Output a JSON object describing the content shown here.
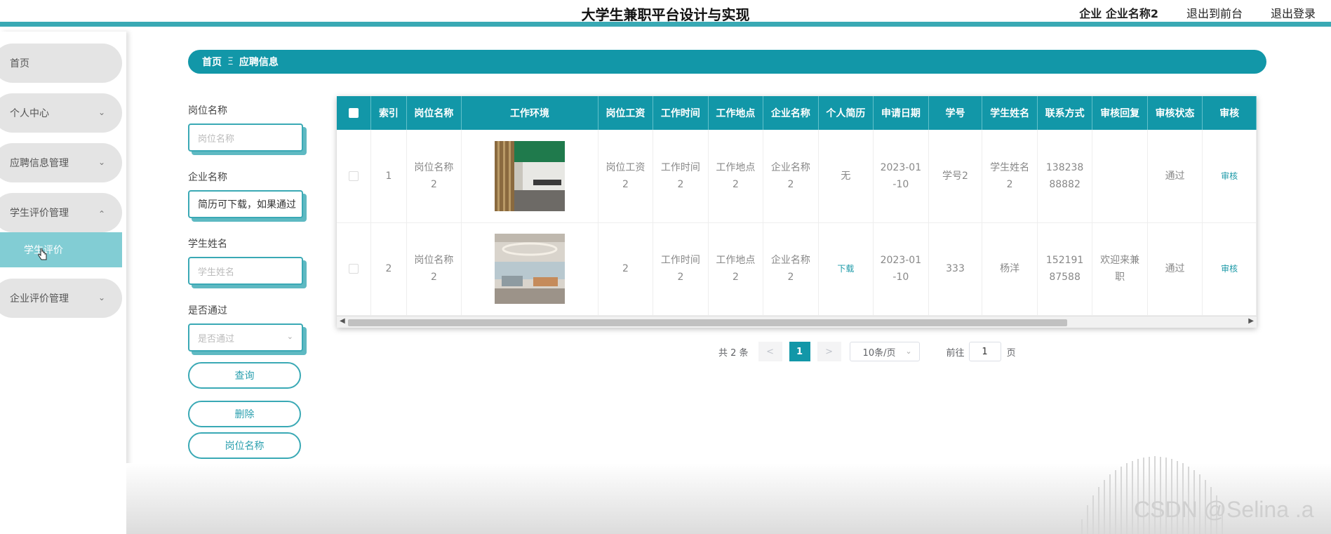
{
  "header": {
    "title": "大学生兼职平台设计与实现",
    "user_label": "企业 企业名称2",
    "to_front": "退出到前台",
    "logout": "退出登录"
  },
  "sidebar": {
    "items": [
      {
        "label": "首页"
      },
      {
        "label": "个人中心"
      },
      {
        "label": "应聘信息管理"
      },
      {
        "label": "学生评价管理"
      },
      {
        "label": "学生评价"
      },
      {
        "label": "企业评价管理"
      }
    ]
  },
  "breadcrumb": {
    "home": "首页",
    "sep": "Ξ",
    "current": "应聘信息"
  },
  "filters": {
    "job_label": "岗位名称",
    "job_placeholder": "岗位名称",
    "company_label": "企业名称",
    "company_value": "简历可下载，如果通过",
    "student_label": "学生姓名",
    "student_placeholder": "学生姓名",
    "pass_label": "是否通过",
    "pass_placeholder": "是否通过",
    "query_btn": "查询",
    "delete_btn": "删除",
    "job_btn": "岗位名称"
  },
  "table": {
    "headers": [
      "索引",
      "岗位名称",
      "工作环境",
      "岗位工资",
      "工作时间",
      "工作地点",
      "企业名称",
      "个人简历",
      "申请日期",
      "学号",
      "学生姓名",
      "联系方式",
      "审核回复",
      "审核状态",
      "审核"
    ],
    "rows": [
      {
        "index": "1",
        "job": "岗位名称2",
        "salary": "岗位工资2",
        "time": "工作时间2",
        "place": "工作地点2",
        "company": "企业名称2",
        "resume": "无",
        "date": "2023-01-10",
        "sno": "学号2",
        "sname": "学生姓名2",
        "phone": "13823888882",
        "reply": "",
        "status": "通过",
        "action": "审核"
      },
      {
        "index": "2",
        "job": "岗位名称2",
        "salary": "2",
        "time": "工作时间2",
        "place": "工作地点2",
        "company": "企业名称2",
        "resume": "下载",
        "date": "2023-01-10",
        "sno": "333",
        "sname": "杨洋",
        "phone": "15219187588",
        "reply": "欢迎来兼职",
        "status": "通过",
        "action": "审核"
      }
    ]
  },
  "pagination": {
    "total": "共 2 条",
    "prev": "<",
    "page": "1",
    "next": ">",
    "size": "10条/页",
    "goto": "前往",
    "goto_value": "1",
    "page_unit": "页"
  },
  "watermark": "CSDN @Selina .a",
  "colors": {
    "accent": "#1297a8",
    "accent_light": "#82cdd4",
    "border": "#3aa9b5"
  }
}
